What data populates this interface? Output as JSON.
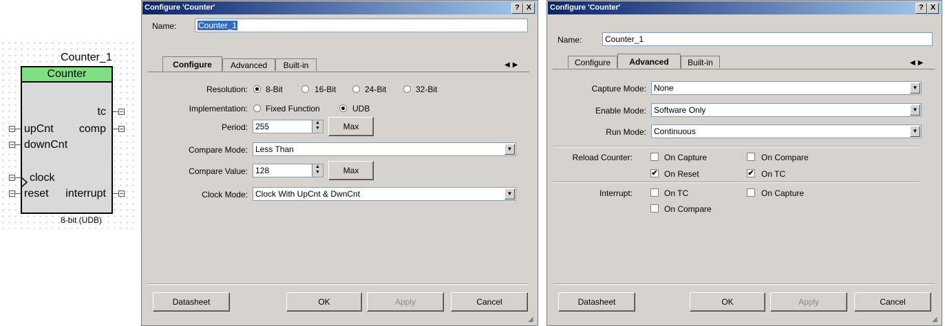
{
  "symbol": {
    "instance_name": "Counter_1",
    "component_name": "Counter",
    "pins_left": [
      "upCnt",
      "downCnt",
      "clock",
      "reset"
    ],
    "pins_right": [
      "tc",
      "comp",
      "interrupt"
    ],
    "footer": "8-bit (UDB)"
  },
  "dialog1": {
    "title": "Configure 'Counter'",
    "help_btn": "?",
    "close_btn": "X",
    "name_label": "Name:",
    "name_value": "Counter_1",
    "tabs": [
      "Configure",
      "Advanced",
      "Built-in"
    ],
    "active_tab": "Configure",
    "resolution": {
      "label": "Resolution:",
      "options": [
        "8-Bit",
        "16-Bit",
        "24-Bit",
        "32-Bit"
      ],
      "selected": "8-Bit"
    },
    "implementation": {
      "label": "Implementation:",
      "options": [
        "Fixed Function",
        "UDB"
      ],
      "selected": "UDB"
    },
    "period": {
      "label": "Period:",
      "value": "255",
      "max_btn": "Max"
    },
    "compare_mode": {
      "label": "Compare Mode:",
      "value": "Less Than"
    },
    "compare_value": {
      "label": "Compare Value:",
      "value": "128",
      "max_btn": "Max"
    },
    "clock_mode": {
      "label": "Clock Mode:",
      "value": "Clock With UpCnt & DwnCnt"
    },
    "buttons": {
      "datasheet": "Datasheet",
      "ok": "OK",
      "apply": "Apply",
      "cancel": "Cancel"
    }
  },
  "dialog2": {
    "title": "Configure 'Counter'",
    "help_btn": "?",
    "close_btn": "X",
    "name_label": "Name:",
    "name_value": "Counter_1",
    "tabs": [
      "Configure",
      "Advanced",
      "Built-in"
    ],
    "active_tab": "Advanced",
    "capture_mode": {
      "label": "Capture Mode:",
      "value": "None"
    },
    "enable_mode": {
      "label": "Enable Mode:",
      "value": "Software Only"
    },
    "run_mode": {
      "label": "Run Mode:",
      "value": "Continuous"
    },
    "reload": {
      "label": "Reload Counter:",
      "options": [
        {
          "label": "On Capture",
          "checked": false
        },
        {
          "label": "On Compare",
          "checked": false
        },
        {
          "label": "On Reset",
          "checked": true
        },
        {
          "label": "On TC",
          "checked": true
        }
      ]
    },
    "interrupt": {
      "label": "Interrupt:",
      "options": [
        {
          "label": "On TC",
          "checked": false
        },
        {
          "label": "On Capture",
          "checked": false
        },
        {
          "label": "On Compare",
          "checked": false
        }
      ]
    },
    "buttons": {
      "datasheet": "Datasheet",
      "ok": "OK",
      "apply": "Apply",
      "cancel": "Cancel"
    }
  },
  "glyphs": {
    "check": "✔",
    "spin_up": "▲",
    "spin_down": "▼",
    "combo": "▼",
    "arrows": "◀▶",
    "grip": "◢"
  }
}
